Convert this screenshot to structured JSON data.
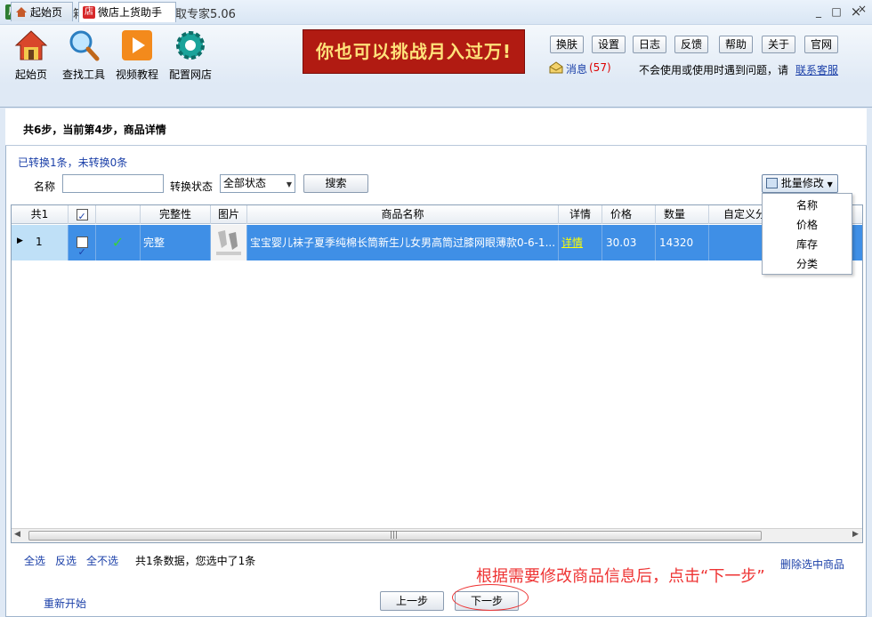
{
  "window": {
    "app_icon_text": "甩",
    "title": "甩手工具箱5.0beta - 商品抓取专家5.06",
    "minimize": "_",
    "maximize": "□",
    "close": "×"
  },
  "toolbar": {
    "tools": [
      {
        "label": "起始页",
        "icon": "home-icon"
      },
      {
        "label": "查找工具",
        "icon": "magnifier-icon"
      },
      {
        "label": "视频教程",
        "icon": "play-icon"
      },
      {
        "label": "配置网店",
        "icon": "gear-icon"
      }
    ],
    "banner": "你也可以挑战月入过万!",
    "buttons": [
      "换肤",
      "设置",
      "日志",
      "反馈",
      "帮助",
      "关于",
      "官网"
    ],
    "message_label": "消息",
    "message_count": "(57)",
    "help_text": "不会使用或使用时遇到问题，请",
    "contact_link": "联系客服"
  },
  "tabs": {
    "home": "起始页",
    "active_badge": "店",
    "active": "微店上货助手",
    "close_all": "×"
  },
  "step": {
    "text": "共6步，当前第4步，商品详情",
    "convert_status": "已转换1条，未转换0条"
  },
  "filter": {
    "name_label": "名称",
    "name_value": "",
    "status_label": "转换状态",
    "status_value": "全部状态",
    "search_button": "搜索"
  },
  "batch": {
    "button": "批量修改",
    "menu": [
      "名称",
      "价格",
      "库存",
      "分类"
    ]
  },
  "grid": {
    "columns": [
      "共1",
      "",
      "",
      "完整性",
      "图片",
      "商品名称",
      "详情",
      "价格",
      "数量",
      "自定义分"
    ],
    "rows": [
      {
        "index": "1",
        "checked": true,
        "completeness": "完整",
        "name": "宝宝婴儿袜子夏季纯棉长筒新生儿女男高筒过膝网眼薄款0-6-1...",
        "detail": "详情",
        "price": "30.03",
        "quantity": "14320",
        "category": ""
      }
    ],
    "scroll_grip": "|||"
  },
  "bottom": {
    "select_all": "全选",
    "invert": "反选",
    "select_none": "全不选",
    "selection_info": "共1条数据，您选中了1条",
    "delete_selected": "删除选中商品",
    "instruction": "根据需要修改商品信息后，点击“下一步”",
    "restart": "重新开始",
    "prev": "上一步",
    "next": "下一步"
  },
  "colors": {
    "selected_row": "#3f8fe6",
    "banner_bg": "#b11b12",
    "banner_text": "#ffe27a",
    "link": "#1a3fa8",
    "instruction": "#e33333",
    "detail_link": "#ffff00"
  }
}
